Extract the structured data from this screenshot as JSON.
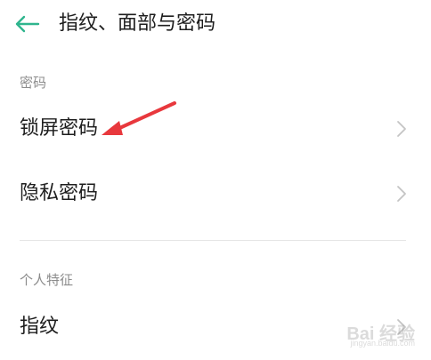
{
  "header": {
    "title": "指纹、面部与密码",
    "back_icon": "arrow-left-icon"
  },
  "sections": [
    {
      "title": "密码",
      "items": [
        {
          "label": "锁屏密码",
          "icon": "chevron-right-icon"
        },
        {
          "label": "隐私密码",
          "icon": "chevron-right-icon"
        }
      ]
    },
    {
      "title": "个人特征",
      "items": [
        {
          "label": "指纹",
          "icon": "chevron-right-icon"
        }
      ]
    }
  ],
  "watermark": {
    "text": "Bai 经验",
    "sub": "jingyan.baidu.com"
  },
  "colors": {
    "accent": "#2fb58e",
    "annotation": "#e8383d",
    "chevron": "#c4c4c4",
    "section_title": "#8c8c8c"
  }
}
